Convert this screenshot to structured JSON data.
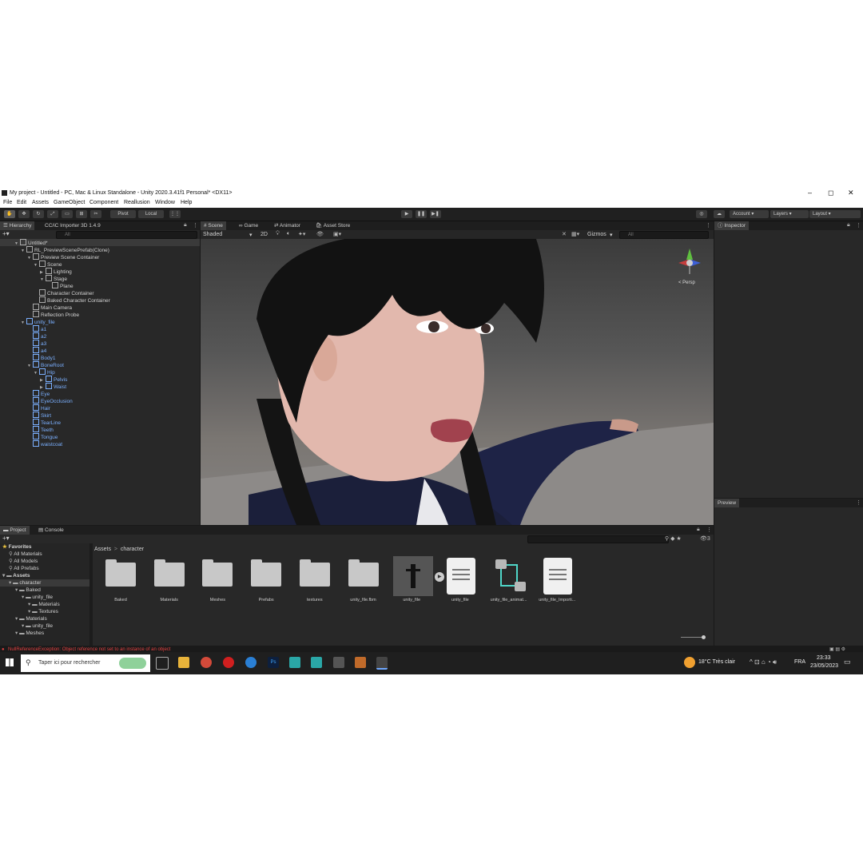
{
  "window": {
    "title": "My project - Untitled - PC, Mac & Linux Standalone - Unity 2020.3.41f1 Personal* <DX11>",
    "controls": [
      "–",
      "◻",
      "✕"
    ]
  },
  "menu": [
    "File",
    "Edit",
    "Assets",
    "GameObject",
    "Component",
    "Reallusion",
    "Window",
    "Help"
  ],
  "toolbar": {
    "pivot": "Pivot",
    "local": "Local",
    "account": "Account",
    "layers": "Layers",
    "layout": "Layout"
  },
  "hierarchy": {
    "tabs": [
      "Hierarchy",
      "CC/iC Importer 3D 1.4.9"
    ],
    "search_placeholder": "All",
    "items": [
      {
        "label": "Untitled*",
        "depth": 0,
        "blue": false,
        "expanded": true
      },
      {
        "label": "RL_PreviewScenePrefab(Clone)",
        "depth": 1,
        "blue": false,
        "expanded": true
      },
      {
        "label": "Preview Scene Container",
        "depth": 2,
        "blue": false,
        "expanded": true
      },
      {
        "label": "Scene",
        "depth": 3,
        "blue": false,
        "expanded": true
      },
      {
        "label": "Lighting",
        "depth": 4,
        "blue": false,
        "expanded": false
      },
      {
        "label": "Stage",
        "depth": 4,
        "blue": false,
        "expanded": true
      },
      {
        "label": "Plane",
        "depth": 5,
        "blue": false,
        "expanded": null
      },
      {
        "label": "Character Container",
        "depth": 3,
        "blue": false,
        "expanded": null
      },
      {
        "label": "Baked Character Container",
        "depth": 3,
        "blue": false,
        "expanded": null
      },
      {
        "label": "Main Camera",
        "depth": 2,
        "blue": false,
        "expanded": null
      },
      {
        "label": "Reflection Probe",
        "depth": 2,
        "blue": false,
        "expanded": null
      },
      {
        "label": "unity_file",
        "depth": 1,
        "blue": true,
        "expanded": true
      },
      {
        "label": "a1",
        "depth": 2,
        "blue": true,
        "expanded": null
      },
      {
        "label": "a2",
        "depth": 2,
        "blue": true,
        "expanded": null
      },
      {
        "label": "a3",
        "depth": 2,
        "blue": true,
        "expanded": null
      },
      {
        "label": "a4",
        "depth": 2,
        "blue": true,
        "expanded": null
      },
      {
        "label": "Body1",
        "depth": 2,
        "blue": true,
        "expanded": null
      },
      {
        "label": "BoneRoot",
        "depth": 2,
        "blue": true,
        "expanded": true
      },
      {
        "label": "Hip",
        "depth": 3,
        "blue": true,
        "expanded": true
      },
      {
        "label": "Pelvis",
        "depth": 4,
        "blue": true,
        "expanded": false
      },
      {
        "label": "Waist",
        "depth": 4,
        "blue": true,
        "expanded": false
      },
      {
        "label": "Eye",
        "depth": 2,
        "blue": true,
        "expanded": null
      },
      {
        "label": "EyeOcclusion",
        "depth": 2,
        "blue": true,
        "expanded": null
      },
      {
        "label": "Hair",
        "depth": 2,
        "blue": true,
        "expanded": null
      },
      {
        "label": "Skirt",
        "depth": 2,
        "blue": true,
        "expanded": null
      },
      {
        "label": "TearLine",
        "depth": 2,
        "blue": true,
        "expanded": null
      },
      {
        "label": "Teeth",
        "depth": 2,
        "blue": true,
        "expanded": null
      },
      {
        "label": "Tongue",
        "depth": 2,
        "blue": true,
        "expanded": null
      },
      {
        "label": "waistcoat",
        "depth": 2,
        "blue": true,
        "expanded": null
      }
    ]
  },
  "scene": {
    "tabs": [
      "Scene",
      "Game",
      "Animator",
      "Asset Store"
    ],
    "shading": "Shaded",
    "mode_2d": "2D",
    "gizmos": "Gizmos",
    "search_placeholder": "All",
    "gizmo_label": "< Persp"
  },
  "inspector": {
    "tab": "Inspector",
    "preview": "Preview"
  },
  "project": {
    "tabs": [
      "Project",
      "Console"
    ],
    "breadcrumb": [
      "Assets",
      "character"
    ],
    "badge": "3",
    "tree": [
      {
        "label": "Favorites",
        "depth": 0,
        "bold": true
      },
      {
        "label": "All Materials",
        "depth": 1
      },
      {
        "label": "All Models",
        "depth": 1
      },
      {
        "label": "All Prefabs",
        "depth": 1
      },
      {
        "label": "Assets",
        "depth": 0,
        "bold": true
      },
      {
        "label": "character",
        "depth": 1,
        "selected": true
      },
      {
        "label": "Baked",
        "depth": 2
      },
      {
        "label": "unity_file",
        "depth": 3
      },
      {
        "label": "Materials",
        "depth": 4
      },
      {
        "label": "Textures",
        "depth": 4
      },
      {
        "label": "Materials",
        "depth": 2
      },
      {
        "label": "unity_file",
        "depth": 3
      },
      {
        "label": "Meshes",
        "depth": 2
      }
    ],
    "assets": [
      {
        "label": "Baked",
        "kind": "folder"
      },
      {
        "label": "Materials",
        "kind": "folder"
      },
      {
        "label": "Meshes",
        "kind": "folder"
      },
      {
        "label": "Prefabs",
        "kind": "folder"
      },
      {
        "label": "textures",
        "kind": "folder"
      },
      {
        "label": "unity_file.fbm",
        "kind": "folder"
      },
      {
        "label": "unity_file",
        "kind": "model"
      },
      {
        "label": "unity_file",
        "kind": "doc"
      },
      {
        "label": "unity_file_animat...",
        "kind": "anim"
      },
      {
        "label": "unity_file_Importi...",
        "kind": "doc"
      }
    ]
  },
  "status": {
    "error": "NullReferenceException: Object reference not set to an instance of an object"
  },
  "taskbar": {
    "search_placeholder": "Taper ici pour rechercher",
    "weather": "18°C  Très clair",
    "lang": "FRA",
    "time": "23:33",
    "date": "23/05/2023"
  }
}
